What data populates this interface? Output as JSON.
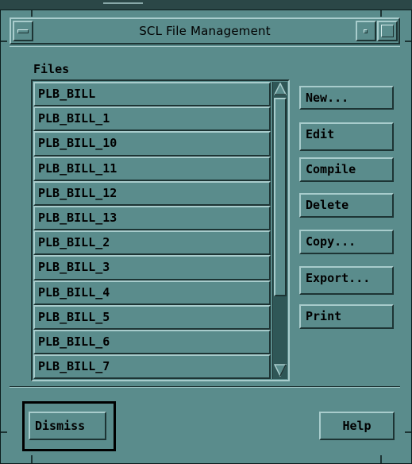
{
  "window": {
    "title": "SCL File Management"
  },
  "files": {
    "label": "Files",
    "items": [
      "PLB_BILL",
      "PLB_BILL_1",
      "PLB_BILL_10",
      "PLB_BILL_11",
      "PLB_BILL_12",
      "PLB_BILL_13",
      "PLB_BILL_2",
      "PLB_BILL_3",
      "PLB_BILL_4",
      "PLB_BILL_5",
      "PLB_BILL_6",
      "PLB_BILL_7"
    ]
  },
  "actions": {
    "new": "New...",
    "edit": "Edit",
    "compile": "Compile",
    "delete": "Delete",
    "copy": "Copy...",
    "export": "Export...",
    "print": "Print"
  },
  "footer": {
    "dismiss": "Dismiss",
    "help": "Help"
  },
  "icons": {
    "window_menu": "window-menu-icon",
    "minimize": "minimize-icon",
    "maximize": "maximize-icon",
    "scroll_up": "scroll-up-arrow-icon",
    "scroll_down": "scroll-down-arrow-icon"
  },
  "colors": {
    "background": "#5a8c8c",
    "highlight": "#a8cccc",
    "shadow": "#1d3434",
    "scroll_trough": "#2f5757"
  }
}
